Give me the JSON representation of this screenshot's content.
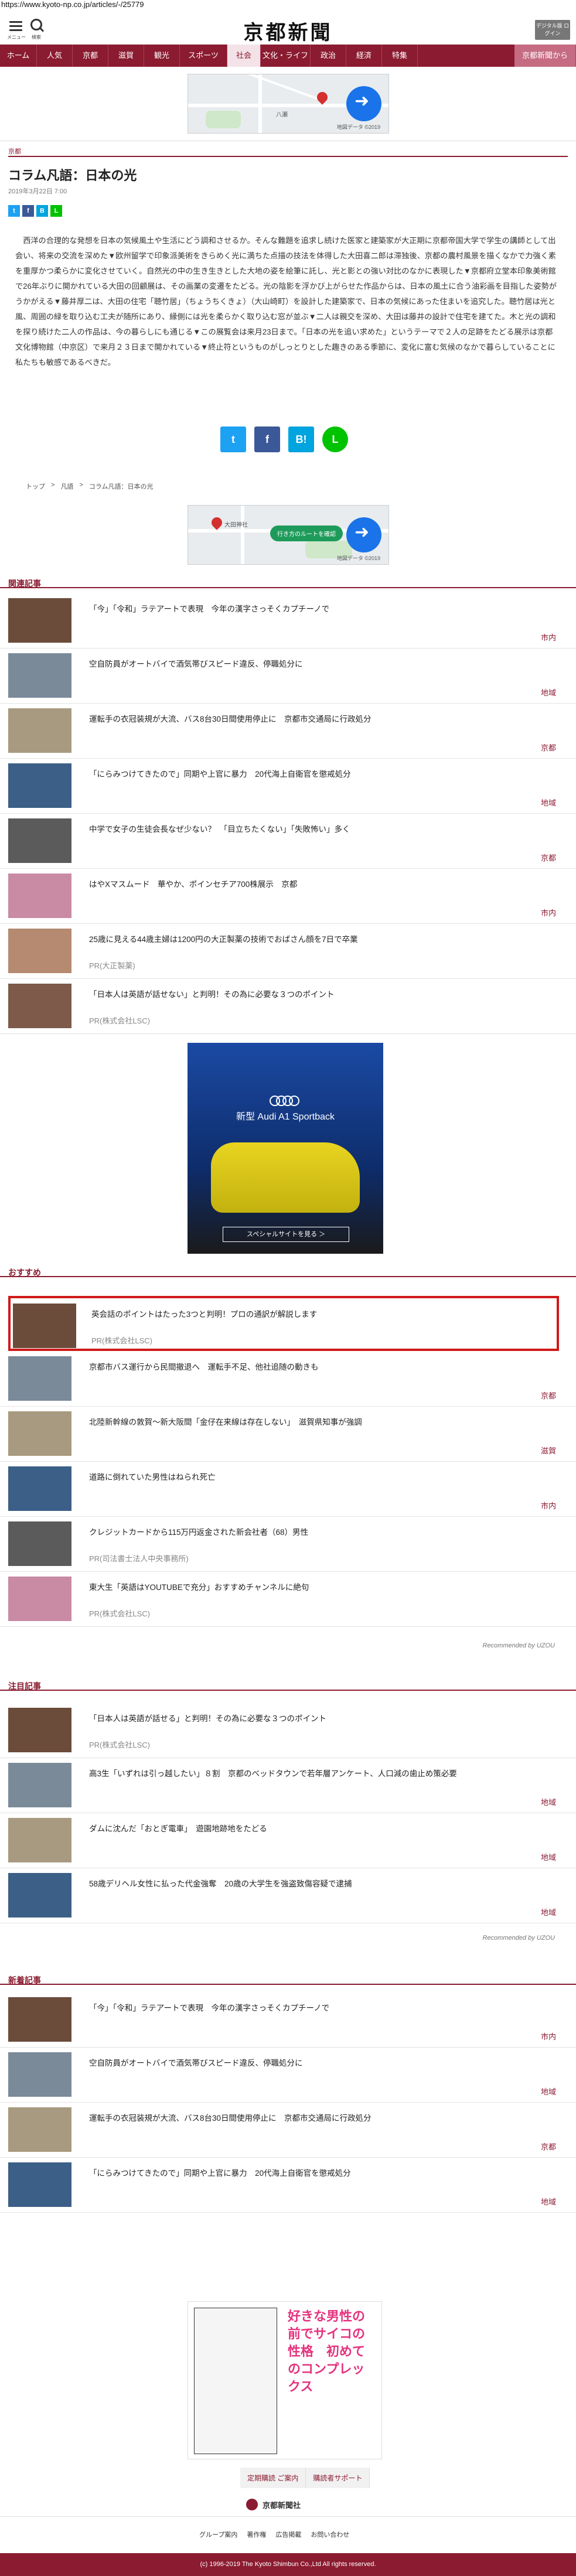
{
  "url": "https://www.kyoto-np.co.jp/articles/-/25779",
  "header": {
    "menu_label": "メニュー",
    "search_label": "検索",
    "logo": "京都新聞",
    "digital_button": "デジタル版 ログイン"
  },
  "nav": [
    "ホーム",
    "人気",
    "京都",
    "滋賀",
    "観光",
    "スポーツ",
    "社会",
    "文化・ライフ",
    "政治",
    "経済",
    "特集",
    "京都新聞から"
  ],
  "nav_active": "社会",
  "map": {
    "credit": "地図データ ©2019",
    "top_label": "八瀬",
    "cta": "行き方のルートを確認",
    "place": "大田神社"
  },
  "article": {
    "category": "京都",
    "title": "コラム凡語：日本の光",
    "date": "2019年3月22日 7:00",
    "body": "西洋の合理的な発想を日本の気候風土や生活にどう調和させるか。そんな難題を追求し続けた医家と建築家が大正期に京都帝国大学で学生の講師として出会い、将来の交流を深めた▼欧州留学で印象派美術をきらめく光に満ちた点描の技法を体得した大田喜二郎は滞独後、京都の農村風景を描くなかで力強く素を重厚かつ柔らかに変化させていく。自然光の中の生き生きとした大地の姿を絵筆に託し、光と影との強い対比のなかに表現した▼京都府立堂本印象美術館で26年ぶりに開かれている大田の回顧展は、その画業の変遷をたどる。光の陰影を浮かび上がらせた作品からは、日本の風土に合う油彩画を目指した姿勢がうかがえる▼藤井厚二は、大田の住宅「聴竹居」（ちょうちくきょ）（大山崎町）を設計した建築家で、日本の気候にあった住まいを追究した。聴竹居は光と風、周囲の緑を取り込む工夫が随所にあり、縁側には光を柔らかく取り込む窓が並ぶ▼二人は親交を深め、大田は藤井の設計で住宅を建てた。木と光の調和を探り続けた二人の作品は、今の暮らしにも通じる▼この展覧会は来月23日まで。「日本の光を追い求めた」というテーマで２人の足跡をたどる展示は京都文化博物館（中京区）で来月２３日まで開かれている▼終止符というものがしっとりとした趣きのある季節に、変化に富む気候のなかで暮らしていることに私たちも敏感であるべきだ。",
    "share_big": [
      "twitter",
      "facebook",
      "hatena",
      "line"
    ]
  },
  "breadcrumb": [
    "トップ",
    "凡語",
    "コラム凡語：日本の光"
  ],
  "related": {
    "heading": "関連記事",
    "items": [
      {
        "title": "「今」「令和」ラテアートで表現　今年の漢字さっそくカプチーノで",
        "cat": "市内"
      },
      {
        "title": "空自防員がオートバイで酒気帯びスピード違反、停職処分に",
        "cat": "地域"
      },
      {
        "title": "運転手の衣冠装規が大流、バス8台30日間使用停止に　京都市交通局に行政処分",
        "cat": "京都"
      },
      {
        "title": "「にらみつけてきたので」同期や上官に暴力　20代海上自衛官を懲戒処分",
        "cat": "地域"
      },
      {
        "title": "中学で女子の生徒会長なぜ少ない？　「目立ちたくない」「失敗怖い」多く",
        "cat": "京都"
      },
      {
        "title": "はやXマスムード　華やか、ポインセチア700株展示　京都",
        "cat": "市内"
      },
      {
        "title": "25歳に見える44歳主婦は1200円の大正製薬の技術でおばさん顔を7日で卒業",
        "pr": "PR(大正製薬)"
      },
      {
        "title": "「日本人は英語が話せない」と判明！その為に必要な３つのポイント",
        "pr": "PR(株式会社LSC)"
      }
    ]
  },
  "audi_ad": {
    "headline": "新型 Audi A1 Sportback",
    "cta": "スペシャルサイトを見る ＞"
  },
  "recommend": {
    "heading": "おすすめ",
    "items": [
      {
        "title": "英会話のポイントはたった3つと判明！プロの通訳が解説します",
        "pr": "PR(株式会社LSC)"
      },
      {
        "title": "京都市バス運行から民間撤退へ　運転手不足、他社追随の動きも",
        "cat": "京都"
      },
      {
        "title": "北陸新幹線の敦賀～新大阪間「金仔在来線は存在しない」　滋賀県知事が強調",
        "cat": "滋賀"
      },
      {
        "title": "道路に倒れていた男性はねられ死亡",
        "cat": "市内"
      },
      {
        "title": "クレジットカードから115万円返金された新会社者（68）男性",
        "pr": "PR(司法書士法人中央事務所)"
      },
      {
        "title": "東大生「英語はYOUTUBEで充分」おすすめチャンネルに絶句",
        "pr": "PR(株式会社LSC)"
      }
    ],
    "credit": "Recommended by UZOU"
  },
  "attention": {
    "heading": "注目記事",
    "items": [
      {
        "title": "「日本人は英語が話せる」と判明！その為に必要な３つのポイント",
        "pr": "PR(株式会社LSC)"
      },
      {
        "title": "高3生「いずれは引っ越したい」８割　京都のベッドタウンで若年層アンケート、人口減の歯止め策必要",
        "cat": "地域"
      },
      {
        "title": "ダムに沈んだ「おとぎ電車」　遊園地跡地をたどる",
        "cat": "地域"
      },
      {
        "title": "58歳デリヘル女性に払った代金強奪　20歳の大学生を強盗致傷容疑で逮捕",
        "cat": "地域"
      }
    ],
    "credit": "Recommended by UZOU"
  },
  "latest": {
    "heading": "新着記事",
    "items": [
      {
        "title": "「今」「令和」ラテアートで表現　今年の漢字さっそくカプチーノで",
        "cat": "市内"
      },
      {
        "title": "空自防員がオートバイで酒気帯びスピード違反、停職処分に",
        "cat": "地域"
      },
      {
        "title": "運転手の衣冠装規が大流、バス8台30日間使用停止に　京都市交通局に行政処分",
        "cat": "京都"
      },
      {
        "title": "「にらみつけてきたので」同期や上官に暴力　20代海上自衛官を懲戒処分",
        "cat": "地域"
      }
    ]
  },
  "manga_ad": {
    "text": "好きな男性の前でサイコの性格　初めてのコンプレックス"
  },
  "footer": {
    "buttons": [
      "定期購読 ご案内",
      "購読者サポート"
    ],
    "logo": "京都新聞社",
    "links": [
      "グループ案内",
      "著作権",
      "広告掲載",
      "お問い合わせ"
    ],
    "copyright": "(c) 1996-2019 The Kyoto Shimbun Co.,Ltd All rights reserved."
  },
  "colors": {
    "brand": "#8b1b30",
    "alert_box": "#d01919"
  }
}
